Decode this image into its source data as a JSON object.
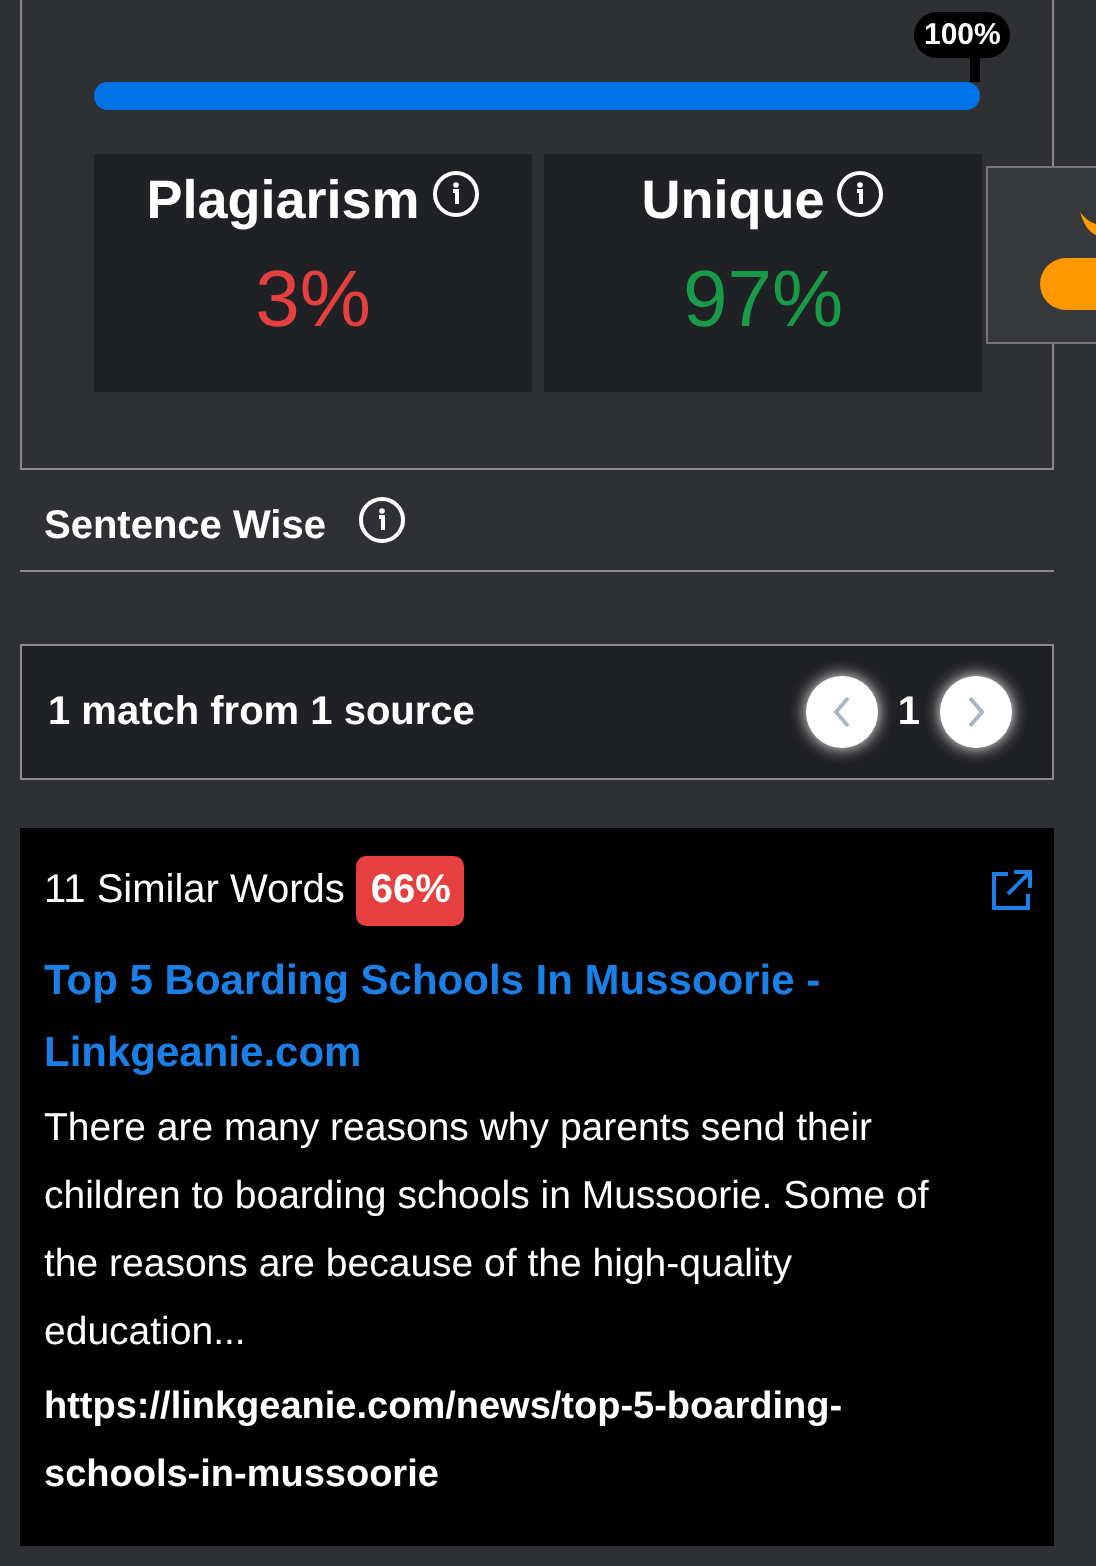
{
  "progress": {
    "level": 1,
    "label": "100%"
  },
  "stats": [
    {
      "label": "Plagiarism",
      "value": "3%",
      "kind": "plagiarism"
    },
    {
      "label": "Unique",
      "value": "97%",
      "kind": "unique"
    }
  ],
  "section": {
    "title": "Sentence Wise"
  },
  "matches": {
    "summary": "1 match from 1 source",
    "page": "1"
  },
  "source": {
    "similar_words": "11 Similar Words",
    "percent": "66%",
    "title": "Top 5 Boarding Schools In Mussoorie - Linkgeanie.com",
    "excerpt": "There are many reasons why parents send their children to boarding schools in Mussoorie. Some of the reasons are because of the high-quality education...",
    "url": "https://linkgeanie.com/news/top-5-boarding-schools-in-mussoorie"
  }
}
